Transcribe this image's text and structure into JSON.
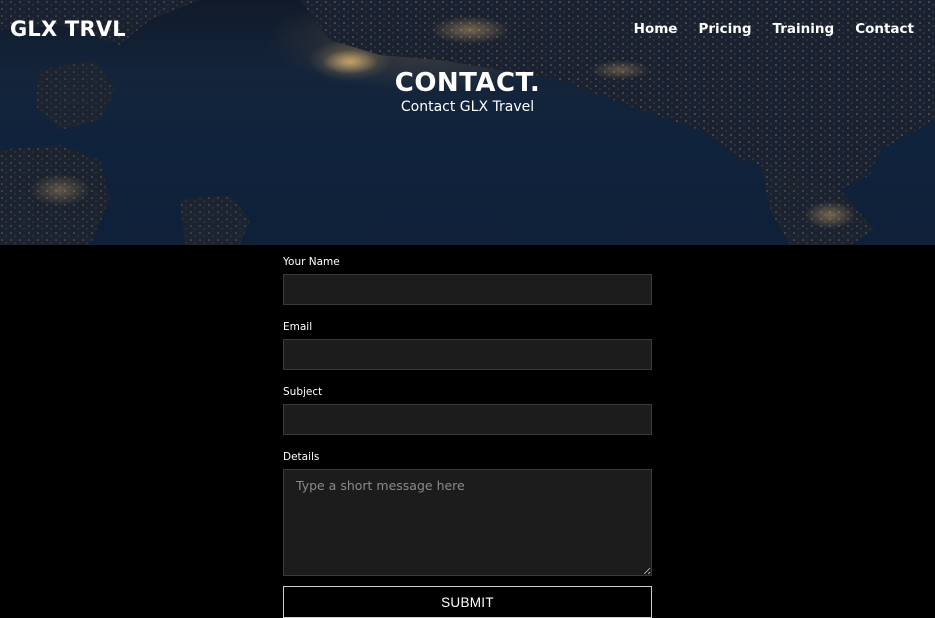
{
  "nav": {
    "logo": "GLX TRVL",
    "links": [
      "Home",
      "Pricing",
      "Training",
      "Contact"
    ]
  },
  "hero": {
    "title": "CONTACT.",
    "subtitle": "Contact GLX Travel"
  },
  "form": {
    "name_label": "Your Name",
    "name_value": "",
    "email_label": "Email",
    "email_value": "",
    "subject_label": "Subject",
    "subject_value": "",
    "details_label": "Details",
    "details_placeholder": "Type a short message here",
    "submit_label": "SUBMIT"
  },
  "colors": {
    "page_background": "#000000",
    "input_background": "#1c1c1c",
    "text": "#ffffff"
  }
}
